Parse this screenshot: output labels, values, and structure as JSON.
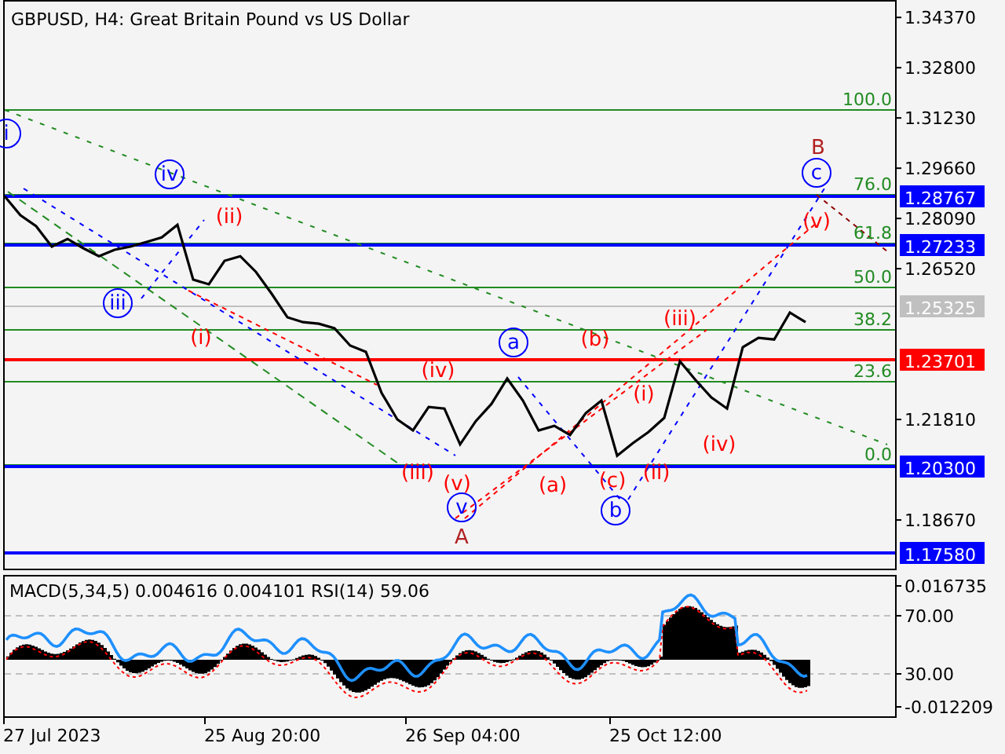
{
  "chart": {
    "title": "GBPUSD, H4:  Great Britain Pound vs US Dollar",
    "chart_data": {
      "type": "line",
      "ylim": [
        1.1715,
        1.3489
      ],
      "yticks": [
        {
          "value": 1.3437,
          "label": "1.34370"
        },
        {
          "value": 1.328,
          "label": "1.32800"
        },
        {
          "value": 1.3123,
          "label": "1.31230"
        },
        {
          "value": 1.2966,
          "label": "1.29660"
        },
        {
          "value": 1.2809,
          "label": "1.28090"
        },
        {
          "value": 1.2652,
          "label": "1.26520"
        },
        {
          "value": 1.2181,
          "label": "1.21810"
        },
        {
          "value": 1.1867,
          "label": "1.18670"
        }
      ],
      "series": [
        {
          "color": "#000000",
          "values": [
            1.2878,
            1.2819,
            1.2785,
            1.2721,
            1.2745,
            1.2716,
            1.2691,
            1.2711,
            1.2721,
            1.2735,
            1.275,
            1.2789,
            1.2618,
            1.2603,
            1.2677,
            1.2691,
            1.2642,
            1.2574,
            1.25,
            1.2485,
            1.248,
            1.2466,
            1.2412,
            1.2392,
            1.2264,
            1.2181,
            1.2147,
            1.222,
            1.2215,
            1.2103,
            1.2176,
            1.223,
            1.2309,
            1.224,
            1.2147,
            1.2161,
            1.2132,
            1.2201,
            1.224,
            1.2068,
            1.2107,
            1.2142,
            1.2186,
            1.2363,
            1.2304,
            1.225,
            1.2215,
            1.2407,
            1.2436,
            1.2431,
            1.2515,
            1.2485
          ]
        }
      ]
    },
    "price_tags": [
      {
        "text": "1.28767",
        "color": "#0000ff"
      },
      {
        "text": "1.27233",
        "color": "#0000ff"
      },
      {
        "text": "1.25325",
        "color": "#c0c0c0"
      },
      {
        "text": "1.23701",
        "color": "#ff0000"
      },
      {
        "text": "1.20300",
        "color": "#0000ff"
      },
      {
        "text": "1.17580",
        "color": "#0000ff"
      }
    ],
    "fib_levels": [
      "100.0",
      "76.0",
      "61.8",
      "50.0",
      "38.2",
      "23.6",
      "0.0"
    ],
    "wave_labels": [
      {
        "text": "i",
        "kind": "circled"
      },
      {
        "text": "iv",
        "kind": "circled"
      },
      {
        "text": "iii",
        "kind": "circled"
      },
      {
        "text": "a",
        "kind": "circled"
      },
      {
        "text": "v",
        "kind": "circled"
      },
      {
        "text": "b",
        "kind": "circled"
      },
      {
        "text": "c",
        "kind": "circled"
      },
      {
        "text": "(ii)",
        "kind": "paren"
      },
      {
        "text": "(i)",
        "kind": "paren"
      },
      {
        "text": "(iv)",
        "kind": "paren"
      },
      {
        "text": "(iii)",
        "kind": "paren"
      },
      {
        "text": "(v)",
        "kind": "paren"
      },
      {
        "text": "(a)",
        "kind": "paren"
      },
      {
        "text": "(b)",
        "kind": "paren"
      },
      {
        "text": "(c)",
        "kind": "paren"
      },
      {
        "text": "(i)",
        "kind": "paren"
      },
      {
        "text": "(ii)",
        "kind": "paren"
      },
      {
        "text": "(iii)",
        "kind": "paren"
      },
      {
        "text": "(iv)",
        "kind": "paren"
      },
      {
        "text": "(v)",
        "kind": "paren"
      },
      {
        "text": "A",
        "kind": "letter"
      },
      {
        "text": "B",
        "kind": "letter"
      }
    ]
  },
  "indicator": {
    "caption": "MACD(5,34,5) 0.004616 0.004101 RSI(14) 59.06",
    "axis": [
      "0.016735",
      "70.00",
      "30.00",
      "-0.012209"
    ]
  },
  "time_axis": [
    "27 Jul 2023",
    "25 Aug 20:00",
    "26 Sep 04:00",
    "25 Oct 12:00"
  ]
}
